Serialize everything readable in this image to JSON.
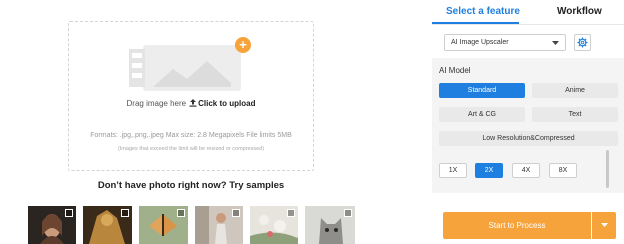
{
  "upload": {
    "drag_text": "Drag image here",
    "click_text": "Click to upload",
    "formats": "Formats: .jpg,.png,.jpeg Max size: 2.8 Megapixels File limits 5MB",
    "limit_note": "(Images that exceed the limit will be resized or compressed)",
    "accent_color": "#f7a33c"
  },
  "samples": {
    "title": "Don’t have photo right now? Try samples",
    "items": [
      {
        "name": "sample-portrait-woman",
        "icon": "photo-thumbnail"
      },
      {
        "name": "sample-golden-statue",
        "icon": "photo-thumbnail"
      },
      {
        "name": "sample-butterfly",
        "icon": "photo-thumbnail"
      },
      {
        "name": "sample-girl-street",
        "icon": "photo-thumbnail"
      },
      {
        "name": "sample-flowers",
        "icon": "photo-thumbnail"
      },
      {
        "name": "sample-cat",
        "icon": "photo-thumbnail"
      }
    ]
  },
  "panel": {
    "tabs": [
      {
        "label": "Select a feature",
        "active": true
      },
      {
        "label": "Workflow",
        "active": false
      }
    ],
    "feature_select": {
      "value": "AI Image Upscaler"
    },
    "model_label": "AI Model",
    "models": [
      {
        "label": "Standard",
        "selected": true
      },
      {
        "label": "Anime",
        "selected": false
      },
      {
        "label": "Art & CG",
        "selected": false
      },
      {
        "label": "Text",
        "selected": false
      },
      {
        "label": "Low Resolution&Compressed",
        "selected": false
      }
    ],
    "scales": [
      {
        "label": "1X",
        "selected": false
      },
      {
        "label": "2X",
        "selected": true
      },
      {
        "label": "4X",
        "selected": false
      },
      {
        "label": "8X",
        "selected": false
      }
    ],
    "process_label": "Start to Process",
    "accent_color": "#1e7fe0",
    "process_color": "#f7a33c"
  }
}
